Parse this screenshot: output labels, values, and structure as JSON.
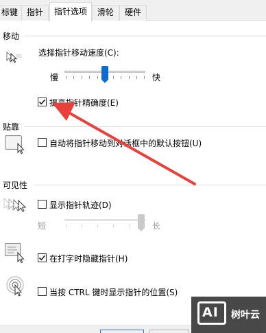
{
  "tabs": [
    {
      "label": "标键",
      "active": false
    },
    {
      "label": "指针",
      "active": false
    },
    {
      "label": "指针选项",
      "active": true
    },
    {
      "label": "滑轮",
      "active": false
    },
    {
      "label": "硬件",
      "active": false
    }
  ],
  "motion": {
    "group_label": "移动",
    "speed_label": "选择指针移动速度(C):",
    "slow_label": "慢",
    "fast_label": "快",
    "speed_level": 0.5,
    "precision": {
      "label": "提高指针精确度(E)",
      "checked": true
    }
  },
  "snap_to": {
    "group_label": "贴靠",
    "checkbox": {
      "label": "自动将指针移动到对话框中的默认按钮(U)",
      "checked": false
    }
  },
  "visibility": {
    "group_label": "可见性",
    "trails": {
      "label": "显示指针轨迹(D)",
      "checked": false
    },
    "short_label": "短",
    "long_label": "长",
    "trail_level": 1.0,
    "hide_typing": {
      "label": "在打字时隐藏指针(H)",
      "checked": true
    },
    "ctrl_show": {
      "label": "当按 CTRL 键时显示指针的位置(S)",
      "checked": false
    }
  },
  "watermark": {
    "logo_text": "AI",
    "name": "树叶云"
  },
  "colors": {
    "accent": "#0f6ccf",
    "arrow": "#e8413c"
  }
}
